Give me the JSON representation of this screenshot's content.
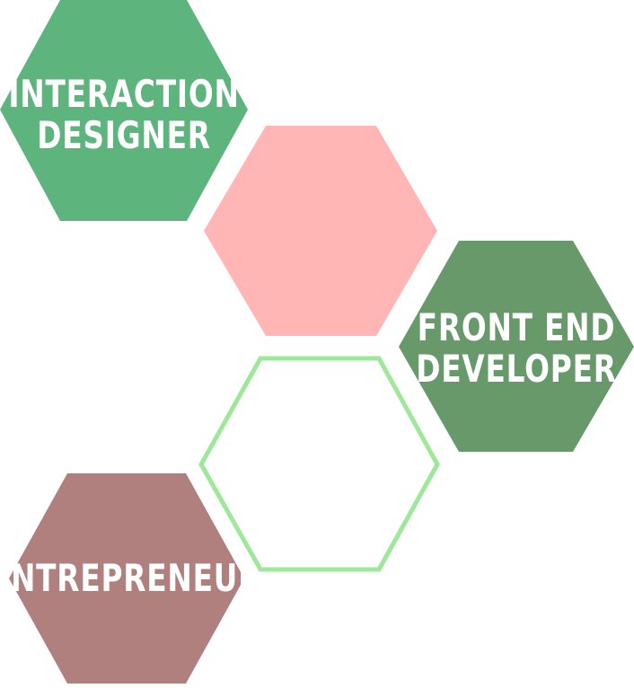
{
  "colors": {
    "interaction": "#5db47c",
    "center_pink": "#ffb6b4",
    "frontend": "#67996a",
    "outline_green": "#9ee89a",
    "entrepreneur": "#b0807e",
    "label_text": "#ffffff"
  },
  "hexagons": [
    {
      "id": "interaction-designer",
      "lines": [
        "INTERACTION",
        "DESIGNER"
      ]
    },
    {
      "id": "center-pink",
      "lines": []
    },
    {
      "id": "front-end-developer",
      "lines": [
        "FRONT END",
        "DEVELOPER"
      ]
    },
    {
      "id": "outline-green",
      "lines": []
    },
    {
      "id": "entrepreneur",
      "lines": [
        "ENTREPRENEUR"
      ]
    }
  ]
}
